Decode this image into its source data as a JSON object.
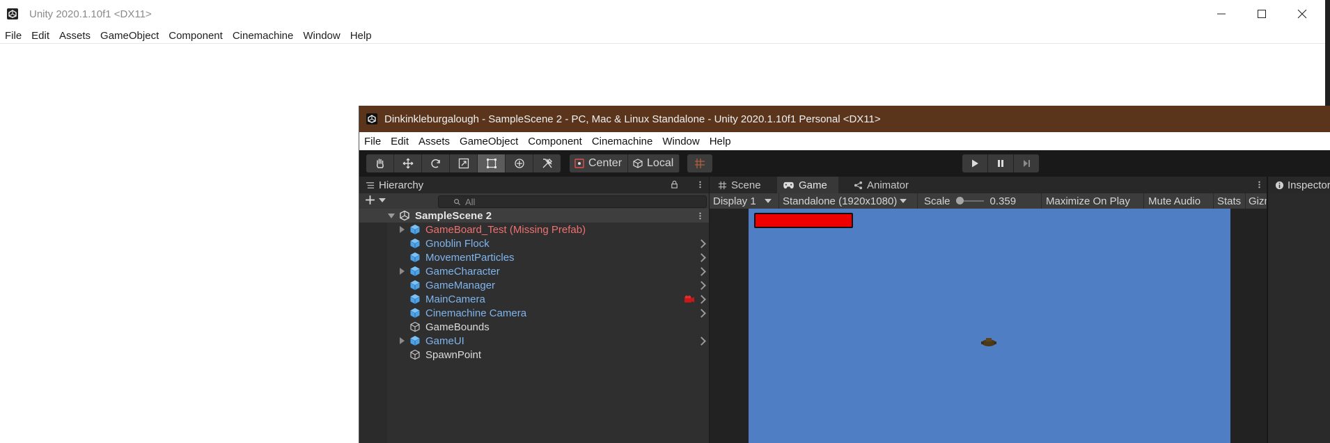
{
  "background_window": {
    "title": "Unity 2020.1.10f1 <DX11>",
    "menu": [
      "File",
      "Edit",
      "Assets",
      "GameObject",
      "Component",
      "Cinemachine",
      "Window",
      "Help"
    ]
  },
  "editor_window": {
    "title": "Dinkinkleburgalough - SampleScene 2 - PC, Mac & Linux Standalone - Unity 2020.1.10f1 Personal <DX11>",
    "title_bar_color": "#5a351c",
    "menu": [
      "File",
      "Edit",
      "Assets",
      "GameObject",
      "Component",
      "Cinemachine",
      "Window",
      "Help"
    ],
    "toolbar": {
      "tools": [
        "hand-tool-icon",
        "move-tool-icon",
        "rotate-tool-icon",
        "scale-tool-icon",
        "rect-tool-icon",
        "transform-tool-icon",
        "custom-tool-icon"
      ],
      "active_tool": "rect-tool-icon",
      "pivot_mode": "Center",
      "pivot_space": "Local"
    }
  },
  "hierarchy": {
    "tab_label": "Hierarchy",
    "search_placeholder": "All",
    "scene_name": "SampleScene 2",
    "items": [
      {
        "name": "GameBoard_Test (Missing Prefab)",
        "type": "missing-prefab",
        "expandable": true,
        "chevron": false
      },
      {
        "name": "Gnoblin Flock",
        "type": "prefab",
        "expandable": false,
        "chevron": true
      },
      {
        "name": "MovementParticles",
        "type": "prefab",
        "expandable": false,
        "chevron": true
      },
      {
        "name": "GameCharacter",
        "type": "prefab",
        "expandable": true,
        "chevron": true
      },
      {
        "name": "GameManager",
        "type": "prefab",
        "expandable": false,
        "chevron": true
      },
      {
        "name": "MainCamera",
        "type": "prefab",
        "expandable": false,
        "chevron": true,
        "gizmo": true
      },
      {
        "name": "Cinemachine Camera",
        "type": "prefab",
        "expandable": false,
        "chevron": true
      },
      {
        "name": "GameBounds",
        "type": "gameobject",
        "expandable": false,
        "chevron": false
      },
      {
        "name": "GameUI",
        "type": "prefab",
        "expandable": true,
        "chevron": true
      },
      {
        "name": "SpawnPoint",
        "type": "gameobject",
        "expandable": false,
        "chevron": false
      }
    ]
  },
  "views": {
    "tabs": [
      "Scene",
      "Game",
      "Animator"
    ],
    "active_tab": "Game",
    "game_toolbar": {
      "display": "Display 1",
      "resolution": "Standalone (1920x1080)",
      "scale_label": "Scale",
      "scale_value": "0.359",
      "maximize": "Maximize On Play",
      "mute": "Mute Audio",
      "stats": "Stats",
      "gizmos": "Gizmos"
    },
    "game_background_color": "#4f7ec5",
    "health_bar_color": "#ee0000"
  },
  "inspector": {
    "tab_label": "Inspector"
  },
  "colors": {
    "missing_prefab_text": "#f07070",
    "prefab_text": "#7fb5ee",
    "default_text": "#dcdcdc"
  }
}
